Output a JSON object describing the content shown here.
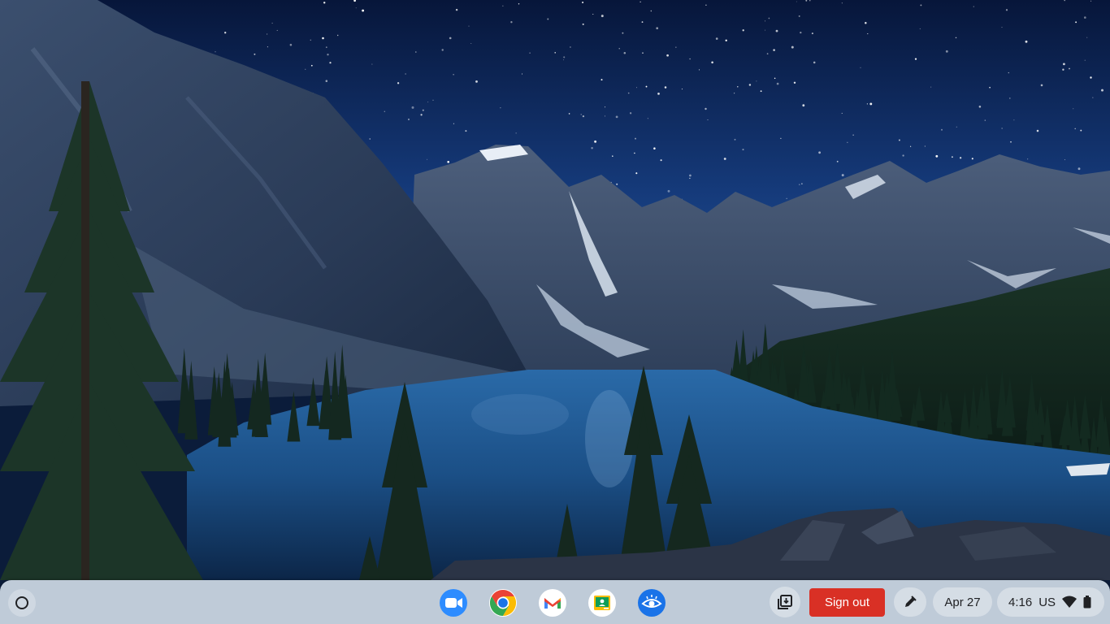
{
  "wallpaper": {
    "description_icon": "mountain-lake-night-wallpaper"
  },
  "shelf": {
    "launcher_icon": "launcher-circle-icon",
    "apps": [
      {
        "name": "Zoom",
        "icon": "zoom-icon"
      },
      {
        "name": "Google Chrome",
        "icon": "chrome-icon"
      },
      {
        "name": "Gmail",
        "icon": "gmail-icon"
      },
      {
        "name": "Google Classroom",
        "icon": "classroom-icon"
      },
      {
        "name": "Screen reader app",
        "icon": "eye-icon"
      }
    ],
    "signout_label": "Sign out",
    "date_label": "Apr 27",
    "time_label": "4:16",
    "ime_label": "US"
  },
  "colors": {
    "shelf_bg": "#cdd8e4",
    "signout_bg": "#d93025",
    "zoom_blue": "#2d8cff",
    "eye_blue": "#1a73e8",
    "sky_top": "#0a1a3d",
    "lake": "#1b4f86"
  }
}
